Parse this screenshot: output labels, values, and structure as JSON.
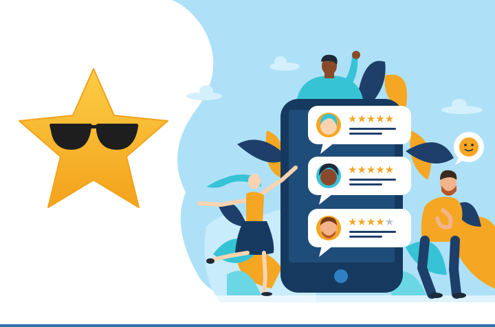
{
  "illustration": {
    "theme": "customer reviews and ratings",
    "icons": [
      "star-with-sunglasses-icon",
      "smiley-speech-bubble-icon",
      "home-button-icon"
    ],
    "colors": {
      "background": "#ffffff",
      "sky": "#aee1f7",
      "star": "#f7b528",
      "phone": "#163a5f",
      "accent_orange": "#f5a623",
      "leaf_dark": "#1e3f6a",
      "leaf_teal": "#37c3d6",
      "bottom_border": "#2f6fb5"
    }
  },
  "reviews": [
    {
      "avatar": "woman-avatar-teal",
      "rating": 5,
      "max_rating": 5
    },
    {
      "avatar": "woman-avatar-curly",
      "rating": 5,
      "max_rating": 5
    },
    {
      "avatar": "man-avatar-beard",
      "rating": 4,
      "max_rating": 5
    }
  ]
}
